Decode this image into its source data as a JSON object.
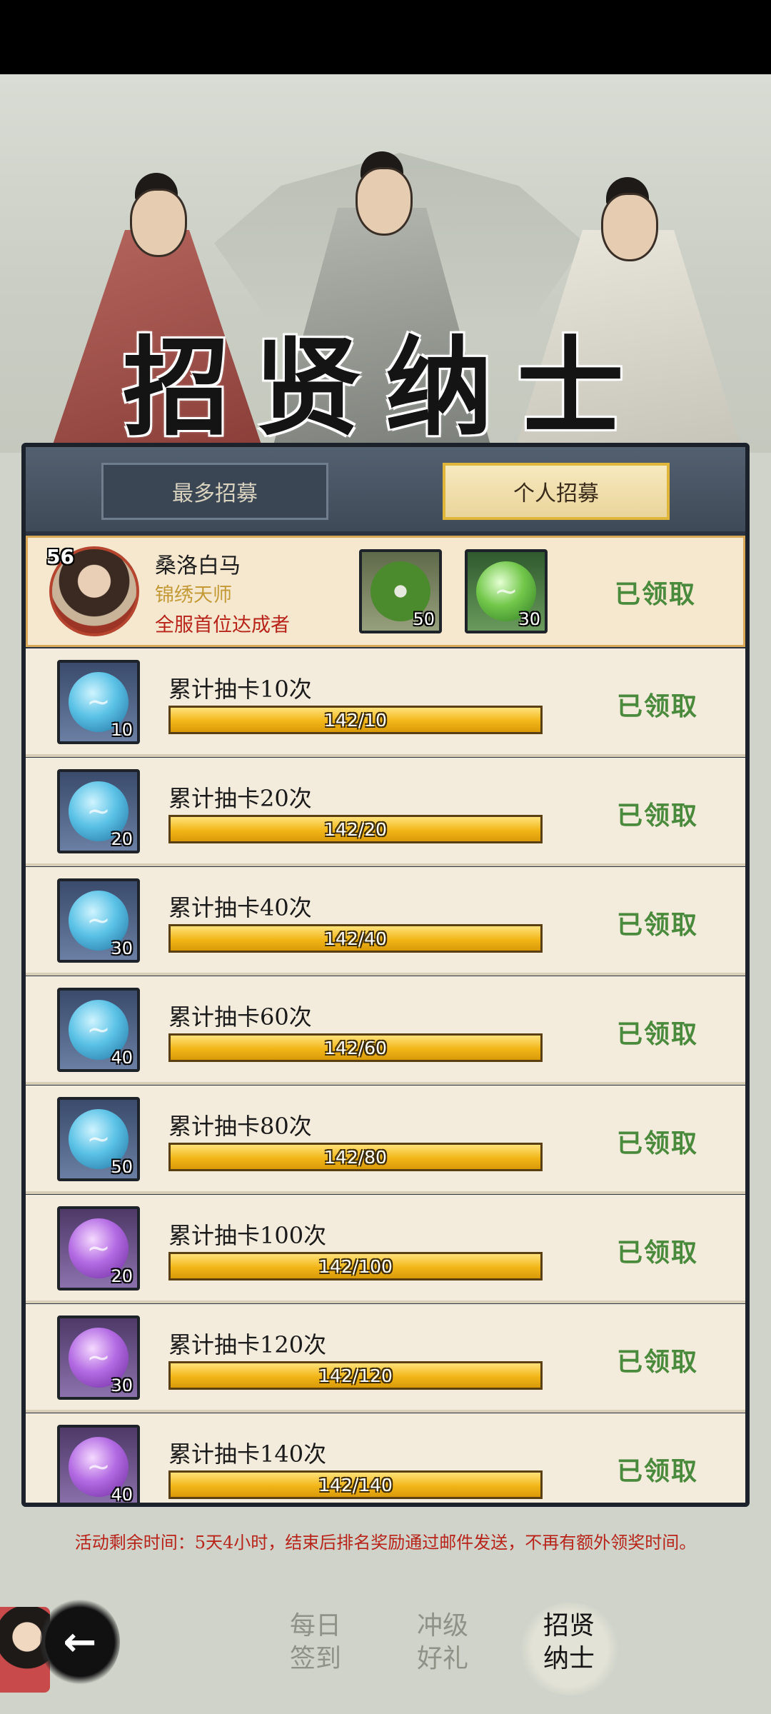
{
  "banner": {
    "title": "招贤纳士"
  },
  "tabs": {
    "most": "最多招募",
    "personal": "个人招募"
  },
  "top_entry": {
    "level": "56",
    "name": "桑洛白马",
    "title": "锦绣天师",
    "achievement": "全服首位达成者",
    "rewards": [
      {
        "icon": "jade-disc-icon",
        "count": "50"
      },
      {
        "icon": "green-orb-icon",
        "count": "30"
      }
    ],
    "status": "已领取"
  },
  "rows": [
    {
      "label": "累计抽卡10次",
      "progress_text": "142/10",
      "progress": 1.0,
      "reward_icon": "blue-orb-icon",
      "reward_count": "10",
      "status": "已领取"
    },
    {
      "label": "累计抽卡20次",
      "progress_text": "142/20",
      "progress": 1.0,
      "reward_icon": "blue-orb-icon",
      "reward_count": "20",
      "status": "已领取"
    },
    {
      "label": "累计抽卡40次",
      "progress_text": "142/40",
      "progress": 1.0,
      "reward_icon": "blue-orb-icon",
      "reward_count": "30",
      "status": "已领取"
    },
    {
      "label": "累计抽卡60次",
      "progress_text": "142/60",
      "progress": 1.0,
      "reward_icon": "blue-orb-icon",
      "reward_count": "40",
      "status": "已领取"
    },
    {
      "label": "累计抽卡80次",
      "progress_text": "142/80",
      "progress": 1.0,
      "reward_icon": "blue-orb-icon",
      "reward_count": "50",
      "status": "已领取"
    },
    {
      "label": "累计抽卡100次",
      "progress_text": "142/100",
      "progress": 1.0,
      "reward_icon": "purple-orb-icon",
      "reward_count": "20",
      "status": "已领取"
    },
    {
      "label": "累计抽卡120次",
      "progress_text": "142/120",
      "progress": 1.0,
      "reward_icon": "purple-orb-icon",
      "reward_count": "30",
      "status": "已领取"
    },
    {
      "label": "累计抽卡140次",
      "progress_text": "142/140",
      "progress": 1.0,
      "reward_icon": "purple-orb-icon",
      "reward_count": "40",
      "status": "已领取"
    }
  ],
  "countdown": "活动剩余时间：5天4小时，结束后排名奖励通过邮件发送，不再有额外领奖时间。",
  "nav": {
    "daily": "每日\n签到",
    "levelup": "冲级\n好礼",
    "recruit": "招贤\n纳士"
  }
}
